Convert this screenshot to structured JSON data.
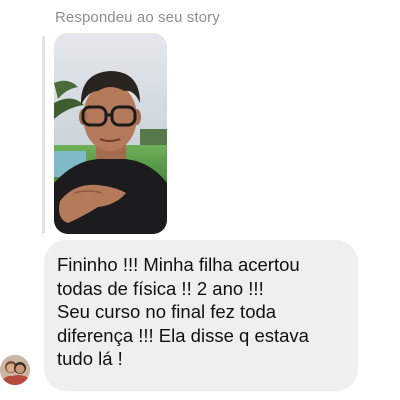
{
  "conversation": {
    "reply_header": "Respondeu ao seu story",
    "story": {
      "kind": "video-thumbnail",
      "description_icon": "story-preview-icon"
    },
    "message": {
      "text": "Fininho !!! Minha filha acertou\ntodas de física !! 2 ano !!!\nSeu curso no final fez toda\ndiferença !!! Ela disse q estava\ntudo lá !"
    },
    "sender": {
      "avatar_icon": "avatar-icon"
    }
  },
  "colors": {
    "background": "#ffffff",
    "bubble": "#efefef",
    "meta_text": "#8e8e93",
    "reply_bar": "#e2e2e4",
    "message_text": "#111111"
  }
}
